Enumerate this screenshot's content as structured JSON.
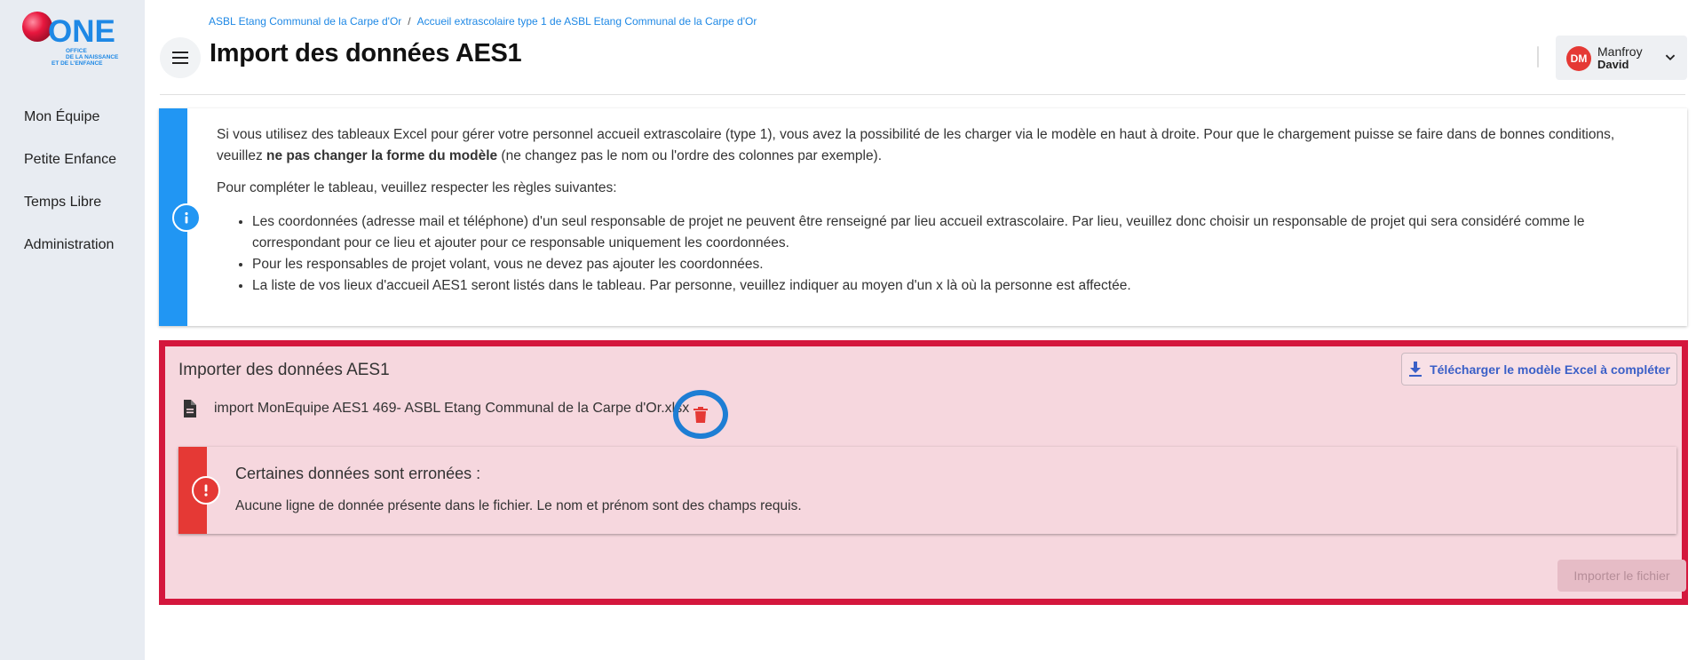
{
  "logo": {
    "brand": "ONE",
    "subtitle_line1": "OFFICE",
    "subtitle_line2": "DE LA NAISSANCE",
    "subtitle_line3": "ET DE L'ENFANCE"
  },
  "sidebar": {
    "items": [
      {
        "label": "Mon Équipe"
      },
      {
        "label": "Petite Enfance"
      },
      {
        "label": "Temps Libre"
      },
      {
        "label": "Administration"
      }
    ]
  },
  "breadcrumb": {
    "items": [
      {
        "label": "ASBL Etang Communal de la Carpe d'Or"
      },
      {
        "label": "Accueil extrascolaire type 1 de ASBL Etang Communal de la Carpe d'Or"
      }
    ],
    "separator": "/"
  },
  "header": {
    "title": "Import des données AES1",
    "menu_icon": "hamburger-menu-icon"
  },
  "user": {
    "initials": "DM",
    "last_name": "Manfroy",
    "first_name": "David",
    "avatar_color": "#e53935"
  },
  "info": {
    "intro_part1": "Si vous utilisez des tableaux Excel pour gérer votre personnel accueil extrascolaire (type 1), vous avez la possibilité de les charger via le modèle en haut à droite. Pour que le chargement puisse se faire dans de bonnes conditions, veuillez ",
    "intro_bold": "ne pas changer la forme du modèle",
    "intro_part2": " (ne changez pas le nom ou l'ordre des colonnes par exemple).",
    "rules_intro": "Pour compléter le tableau, veuillez respecter les règles suivantes:",
    "rules": [
      "Les coordonnées (adresse mail et téléphone) d'un seul responsable de projet ne peuvent être renseigné par lieu accueil extrascolaire. Par lieu, veuillez donc choisir un responsable de projet qui sera considéré comme le correspondant pour ce lieu et ajouter pour ce responsable uniquement les coordonnées.",
      "Pour les responsables de projet volant, vous ne devez pas ajouter les coordonnées.",
      "La liste de vos lieux d'accueil AES1 seront listés dans le tableau. Par personne, veuillez indiquer au moyen d'un x là où la personne est affectée."
    ],
    "accent_color": "#2196f3"
  },
  "import_panel": {
    "title": "Importer des données AES1",
    "download_button": "Télécharger le modèle Excel à compléter",
    "file_name": "import MonEquipe AES1 469- ASBL Etang Communal de la Carpe d'Or.xlsx",
    "error_title": "Certaines données sont erronées :",
    "error_message": "Aucune ligne de donnée présente dans le fichier. Le nom et prénom sont des champs requis.",
    "import_button": "Importer le fichier",
    "highlight_color": "#d4173d",
    "circle_color": "#1e7ed4",
    "error_color": "#e53935"
  }
}
